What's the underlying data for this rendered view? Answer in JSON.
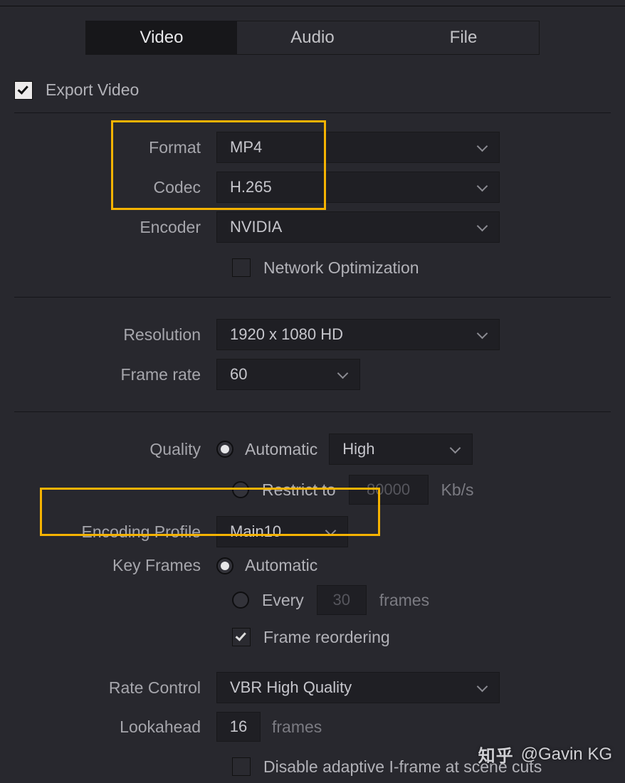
{
  "tabs": {
    "video": "Video",
    "audio": "Audio",
    "file": "File"
  },
  "export": {
    "label": "Export Video"
  },
  "format": {
    "label": "Format",
    "value": "MP4"
  },
  "codec": {
    "label": "Codec",
    "value": "H.265"
  },
  "encoder": {
    "label": "Encoder",
    "value": "NVIDIA"
  },
  "netopt": {
    "label": "Network Optimization"
  },
  "resolution": {
    "label": "Resolution",
    "value": "1920 x 1080 HD"
  },
  "framerate": {
    "label": "Frame rate",
    "value": "60"
  },
  "quality": {
    "label": "Quality",
    "auto": "Automatic",
    "preset": "High",
    "restrict": "Restrict to",
    "bitrate": "80000",
    "unit": "Kb/s"
  },
  "profile": {
    "label": "Encoding Profile",
    "value": "Main10"
  },
  "keyframes": {
    "label": "Key Frames",
    "auto": "Automatic",
    "every": "Every",
    "count": "30",
    "unit": "frames",
    "reorder": "Frame reordering"
  },
  "ratecontrol": {
    "label": "Rate Control",
    "value": "VBR High Quality"
  },
  "lookahead": {
    "label": "Lookahead",
    "value": "16",
    "unit": "frames"
  },
  "disable_iframe": {
    "label": "Disable adaptive I-frame at scene cuts"
  },
  "watermark": {
    "site": "知乎",
    "author": "@Gavin KG"
  }
}
